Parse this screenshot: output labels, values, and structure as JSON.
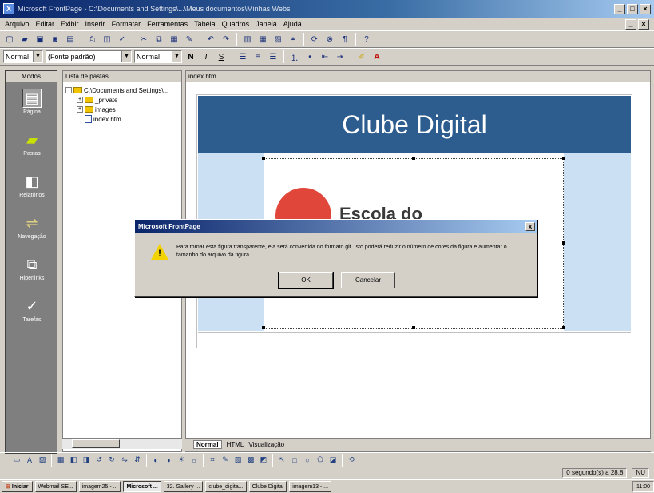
{
  "window": {
    "title": "Microsoft FrontPage - C:\\Documents and Settings\\...\\Meus documentos\\Minhas Webs",
    "app_icon": "X"
  },
  "menubar": [
    "Arquivo",
    "Editar",
    "Exibir",
    "Inserir",
    "Formatar",
    "Ferramentas",
    "Tabela",
    "Quadros",
    "Janela",
    "Ajuda"
  ],
  "format_toolbar": {
    "style": "Normal",
    "font": "(Fonte padrão)",
    "size": "Normal",
    "bold": "N",
    "italic": "I",
    "underline": "S",
    "font_color": "A"
  },
  "modes": {
    "header": "Modos",
    "items": [
      {
        "label": "Página",
        "icon": "page-icon",
        "glyph": "▤"
      },
      {
        "label": "Pastas",
        "icon": "folder-icon",
        "glyph": "▰"
      },
      {
        "label": "Relatórios",
        "icon": "reports-icon",
        "glyph": "◧"
      },
      {
        "label": "Navegação",
        "icon": "navigation-icon",
        "glyph": "⇌"
      },
      {
        "label": "Hiperlinks",
        "icon": "hyperlinks-icon",
        "glyph": "⧉"
      },
      {
        "label": "Tarefas",
        "icon": "tasks-icon",
        "glyph": "✓"
      }
    ]
  },
  "folders": {
    "header": "Lista de pastas",
    "root": "C:\\Documents and Settings\\...",
    "items": [
      {
        "name": "_private",
        "type": "folder"
      },
      {
        "name": "images",
        "type": "folder"
      },
      {
        "name": "index.htm",
        "type": "file"
      }
    ]
  },
  "editor": {
    "tab": "index.htm",
    "banner": "Clube Digital",
    "logo_text": "Escola do"
  },
  "dialog": {
    "title": "Microsoft FrontPage",
    "close": "x",
    "message": "Para tornar esta figura transparente, ela será convertida no formato gif. Isto poderá reduzir o número de cores da figura e aumentar o tamanho do arquivo da figura.",
    "ok": "OK",
    "cancel": "Cancelar"
  },
  "view_tabs": {
    "normal": "Normal",
    "html": "HTML",
    "preview": "Visualização"
  },
  "status": {
    "time": "0 segundo(s) a 28.8",
    "mode": "NU"
  },
  "taskbar": {
    "start": "Iniciar",
    "tasks": [
      "Webmail SE...",
      "imagem25 - ...",
      "Microsoft ...",
      "32. Gallery ...",
      "clube_digita...",
      "Clube Digital",
      "imagem13 - ..."
    ],
    "active_index": 2,
    "clock": "11:00"
  }
}
